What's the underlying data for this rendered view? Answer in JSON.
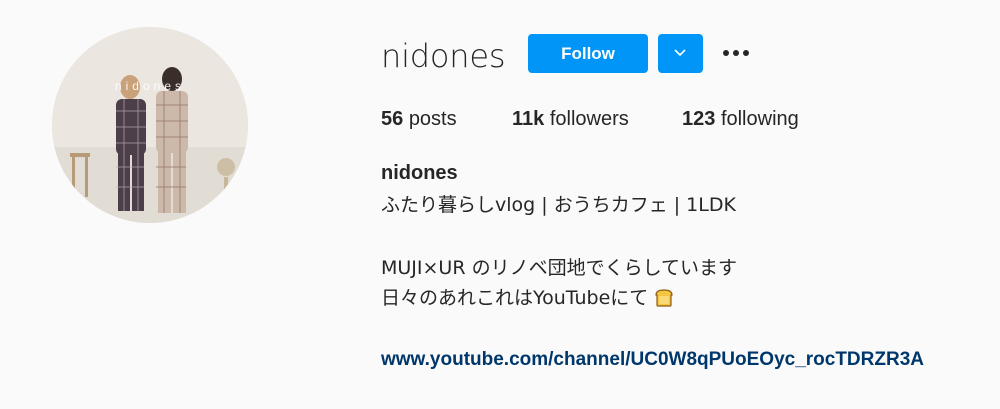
{
  "profile": {
    "avatar_wordmark": "nidones",
    "username": "nidones",
    "follow_label": "Follow",
    "stats": {
      "posts_count": "56",
      "posts_label": "posts",
      "followers_count": "11k",
      "followers_label": "followers",
      "following_count": "123",
      "following_label": "following"
    },
    "full_name": "nidones",
    "bio_lines": [
      "ふたり暮らしvlog | おうちカフェ | 1LDK",
      "MUJI×UR のリノベ団地でくらしています",
      "日々のあれこれはYouTubeにて"
    ],
    "bio_emoji_icon": "bread-icon",
    "link": "www.youtube.com/channel/UC0W8qPUoEOyc_rocTDRZR3A"
  },
  "colors": {
    "primary_button": "#0095f6",
    "link": "#00376b",
    "text": "#262626",
    "background": "#fafafa"
  }
}
